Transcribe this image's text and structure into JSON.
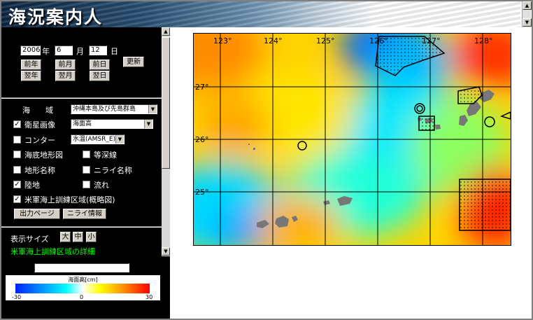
{
  "app": {
    "title": "海況案内人"
  },
  "date": {
    "year": "2006",
    "year_unit": "年",
    "month": "6",
    "month_unit": "月",
    "day": "12",
    "day_unit": "日",
    "prev_year": "前年",
    "next_year": "翌年",
    "prev_month": "前月",
    "next_month": "翌月",
    "prev_day": "前日",
    "next_day": "翌日",
    "update": "更新"
  },
  "sea_area": {
    "label": "海　　域",
    "value": "沖縄本島及び先島群島"
  },
  "layers": {
    "satellite": {
      "label": "衛星画像",
      "checked": true,
      "value": "海面高"
    },
    "contour": {
      "label": "コンター",
      "checked": false,
      "value": "水温(AMSR_E)"
    },
    "bathymetry": {
      "label": "海底地形図",
      "checked": false
    },
    "isobath": {
      "label": "等深線",
      "checked": false
    },
    "place_names": {
      "label": "地形名称",
      "checked": false
    },
    "nirai_names": {
      "label": "ニライ名称",
      "checked": false
    },
    "land": {
      "label": "陸地",
      "checked": true
    },
    "flow": {
      "label": "流れ",
      "checked": false
    },
    "training_area": {
      "label": "米軍海上訓練区域(概略図)",
      "checked": true
    }
  },
  "buttons": {
    "output_page": "出力ページ",
    "nirai_info": "ニライ情報"
  },
  "display_size": {
    "label": "表示サイズ",
    "large": "大",
    "medium": "中",
    "small": "小"
  },
  "links": {
    "training_detail": "米軍海上訓練区域の詳細"
  },
  "legend": {
    "title": "海面高[cm]",
    "min": "-30",
    "mid": "0",
    "max": "30"
  },
  "map": {
    "lon_labels": [
      "123°",
      "124°",
      "125°",
      "126°",
      "127°",
      "128°"
    ],
    "lat_labels": [
      "27°",
      "26°",
      "25°"
    ]
  },
  "colors": {
    "panel_bg": "#000000",
    "link": "#00ff00"
  }
}
